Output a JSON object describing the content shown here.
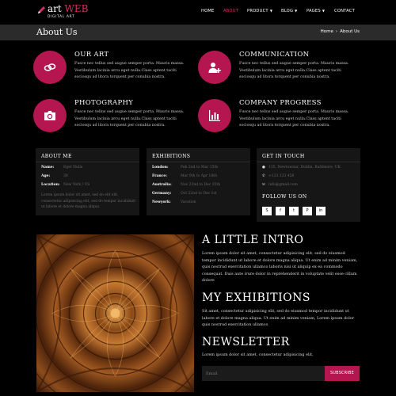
{
  "header": {
    "logo_prefix": "art",
    "logo_accent": "WEB",
    "logo_sub": "DIGITAL ART",
    "nav": [
      "HOME",
      "ABOUT",
      "PRODUCT",
      "BLOG",
      "PAGES",
      "CONTACT"
    ],
    "active_nav": "ABOUT"
  },
  "titlebar": {
    "title": "About Us",
    "crumb_home": "Home",
    "crumb_sep": "›",
    "crumb_current": "About Us"
  },
  "services": [
    {
      "icon": "link-icon",
      "title": "OUR ART",
      "text": "Fusce nec tellus sed augue semper porta. Mauris massa. Vestibulum lacinia arcu eget nulla.Class aptent taciti sociosqu ad litora torquent per conubia nostra."
    },
    {
      "icon": "add-user-icon",
      "title": "COMMUNICATION",
      "text": "Fusce nec tellus sed augue semper porta. Mauris massa. Vestibulum lacinia arcu eget nulla.Class aptent taciti sociosqu ad litora torquent per conubia nostra."
    },
    {
      "icon": "camera-icon",
      "title": "PHOTOGRAPHY",
      "text": "Fusce nec tellus sed augue semper porta. Mauris massa. Vestibulum lacinia arcu eget nulla.Class aptent taciti sociosqu ad litora torquent per conubia nostra."
    },
    {
      "icon": "bar-chart-icon",
      "title": "COMPANY PROGRESS",
      "text": "Fusce nec tellus sed augue semper porta. Mauris massa. Vestibulum lacinia arcu eget nulla.Class aptent taciti sociosqu ad litora torquent per conubia nostra."
    }
  ],
  "about_me": {
    "title": "ABOUT ME",
    "rows": [
      {
        "k": "Name:",
        "v": "Eget Nulla"
      },
      {
        "k": "Age:",
        "v": "30"
      },
      {
        "k": "Location:",
        "v": "New York / US"
      }
    ],
    "note": "Lorem ipsum dolor sit amet, sed do elit elit, consectetur adipisicing elit, sed do tempor incididunt ut labore et dolore magna aliqua."
  },
  "exhibitions": {
    "title": "EXHIBITIONS",
    "rows": [
      {
        "k": "London:",
        "v": "Feb 2nd to Mar 15th"
      },
      {
        "k": "France:",
        "v": "Mar 9th to Apr 18th"
      },
      {
        "k": "Australia:",
        "v": "Nov 22nd to Dec 25th"
      },
      {
        "k": "Germany:",
        "v": "Oct 22nd to Dec 1st"
      },
      {
        "k": "Newyork:",
        "v": "Vacation"
      }
    ]
  },
  "get_in_touch": {
    "title": "GET IN TOUCH",
    "address": "135, Newtownar, Dublin, Baltimore, UK",
    "phone": "+123 123 456",
    "email": "info@gmail.com",
    "follow_title": "FOLLOW US ON",
    "socials": [
      "skype-icon",
      "facebook-icon",
      "twitter-icon",
      "pinterest-icon",
      "linkedin-icon"
    ],
    "social_glyphs": [
      "S",
      "f",
      "t",
      "P",
      "in"
    ]
  },
  "intro": {
    "title": "A LITTLE INTRO",
    "text": "Lorem ipsum dolor sit amet, consectetur adipisicing elit, sed do eiusmod tempor incididunt ut labore et dolore magna aliqua. Ut enim ad minim veniam, quis nostrud exercitation ullamco laboris nisi ut aliquip ex ea commodo consequat. Duis aute irure dolor in reprehenderit in voluptate velit esse cillum dolore"
  },
  "exhibitions_section": {
    "title": "MY EXHIBITIONS",
    "text": "Sit amet, consectetur adipisicing elit, sed do eiusmod tempor incididunt ut labore et dolore magna aliqua. Ut enim ad minim veniam, Lorem ipsum dolor quis nostrud exercitation ullamco"
  },
  "newsletter": {
    "title": "NEWSLETTER",
    "text": "Lorem ipsum dolor sit amet, consectetur adipisicing elit,",
    "placeholder": "Email",
    "button": "SUBSCRIBE"
  },
  "colors": {
    "accent": "#b5164f",
    "accent_text": "#d62f6b",
    "background": "#000000",
    "panel": "#161616",
    "titlebar": "#2b2b2b"
  }
}
